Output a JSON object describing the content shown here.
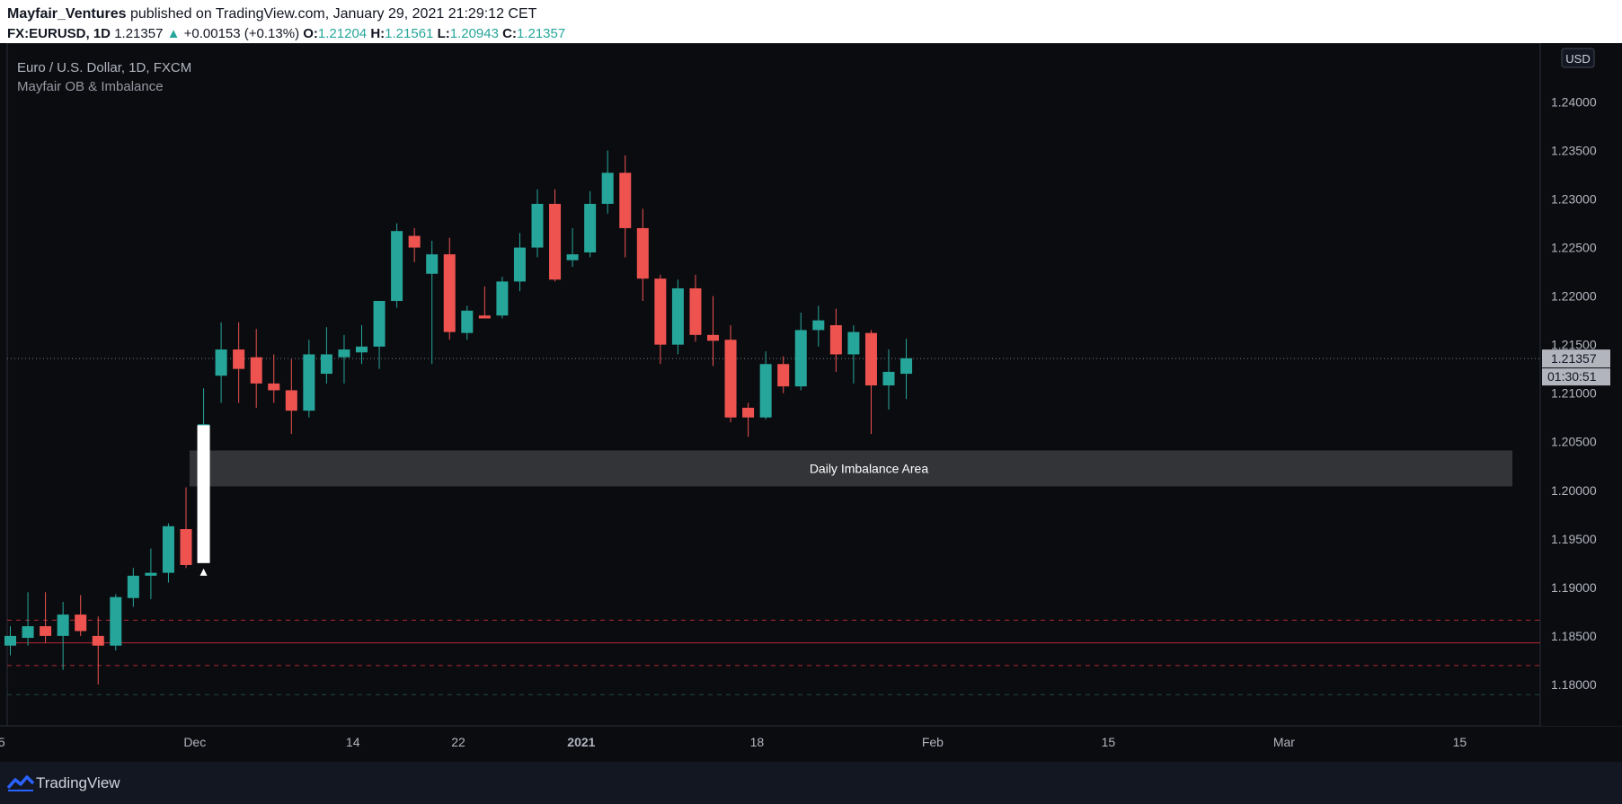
{
  "header": {
    "author": "Mayfair_Ventures",
    "published_text": "published on TradingView.com, January 29, 2021 21:29:12 CET",
    "symbol": "FX:EURUSD,",
    "interval": "1D",
    "last": "1.21357",
    "change": "+0.00153 (+0.13%)",
    "o_label": "O:",
    "o_val": "1.21204",
    "h_label": "H:",
    "h_val": "1.21561",
    "l_label": "L:",
    "l_val": "1.20943",
    "c_label": "C:",
    "c_val": "1.21357"
  },
  "chart_title": "Euro / U.S. Dollar, 1D, FXCM",
  "indicator_name": "Mayfair OB & Imbalance",
  "currency_label": "USD",
  "countdown": "01:30:51",
  "footer": {
    "brand": "TradingView"
  },
  "colors": {
    "up": "#26a69a",
    "down": "#ef5350",
    "background": "#0b0c10",
    "header_bg": "#ffffff"
  },
  "chart_data": {
    "type": "candlestick",
    "symbol": "FX:EURUSD",
    "interval": "1D",
    "ylim": [
      1.1762,
      1.2455
    ],
    "y_ticks": [
      "1.18000",
      "1.18500",
      "1.19000",
      "1.19500",
      "1.20000",
      "1.20500",
      "1.21000",
      "1.21500",
      "1.22000",
      "1.22500",
      "1.23000",
      "1.23500",
      "1.24000"
    ],
    "x_ticks": [
      {
        "label": "5",
        "bar": -0.5,
        "bold": false
      },
      {
        "label": "Dec",
        "bar": 10.5,
        "bold": false
      },
      {
        "label": "14",
        "bar": 19.5,
        "bold": false
      },
      {
        "label": "22",
        "bar": 25.5,
        "bold": false
      },
      {
        "label": "2021",
        "bar": 32.5,
        "bold": true
      },
      {
        "label": "18",
        "bar": 42.5,
        "bold": false
      },
      {
        "label": "Feb",
        "bar": 52.5,
        "bold": false
      },
      {
        "label": "15",
        "bar": 62.5,
        "bold": false
      },
      {
        "label": "Mar",
        "bar": 72.5,
        "bold": false
      },
      {
        "label": "15",
        "bar": 82.5,
        "bold": false
      }
    ],
    "candles": [
      {
        "o": 1.184,
        "h": 1.186,
        "l": 1.183,
        "c": 1.185
      },
      {
        "o": 1.1848,
        "h": 1.1895,
        "l": 1.184,
        "c": 1.186
      },
      {
        "o": 1.186,
        "h": 1.1895,
        "l": 1.1843,
        "c": 1.185
      },
      {
        "o": 1.185,
        "h": 1.1885,
        "l": 1.1815,
        "c": 1.1872
      },
      {
        "o": 1.1872,
        "h": 1.1892,
        "l": 1.185,
        "c": 1.1855
      },
      {
        "o": 1.185,
        "h": 1.187,
        "l": 1.18,
        "c": 1.184
      },
      {
        "o": 1.184,
        "h": 1.1893,
        "l": 1.1835,
        "c": 1.189
      },
      {
        "o": 1.1889,
        "h": 1.192,
        "l": 1.188,
        "c": 1.1912
      },
      {
        "o": 1.1912,
        "h": 1.194,
        "l": 1.1888,
        "c": 1.1915
      },
      {
        "o": 1.1915,
        "h": 1.1966,
        "l": 1.1905,
        "c": 1.1963
      },
      {
        "o": 1.196,
        "h": 1.2003,
        "l": 1.192,
        "c": 1.1923
      },
      {
        "o": 1.2021,
        "h": 1.2105,
        "l": 1.2015,
        "c": 1.2068
      },
      {
        "o": 1.2118,
        "h": 1.2173,
        "l": 1.209,
        "c": 1.2145
      },
      {
        "o": 1.2145,
        "h": 1.2173,
        "l": 1.209,
        "c": 1.2125
      },
      {
        "o": 1.2137,
        "h": 1.2166,
        "l": 1.2085,
        "c": 1.211
      },
      {
        "o": 1.211,
        "h": 1.214,
        "l": 1.209,
        "c": 1.2103
      },
      {
        "o": 1.2103,
        "h": 1.2135,
        "l": 1.2058,
        "c": 1.2082
      },
      {
        "o": 1.2082,
        "h": 1.2155,
        "l": 1.2075,
        "c": 1.214
      },
      {
        "o": 1.212,
        "h": 1.2168,
        "l": 1.211,
        "c": 1.214
      },
      {
        "o": 1.2137,
        "h": 1.216,
        "l": 1.211,
        "c": 1.2145
      },
      {
        "o": 1.2142,
        "h": 1.217,
        "l": 1.213,
        "c": 1.2148
      },
      {
        "o": 1.2148,
        "h": 1.2195,
        "l": 1.2125,
        "c": 1.2195
      },
      {
        "o": 1.2195,
        "h": 1.2275,
        "l": 1.2188,
        "c": 1.2267
      },
      {
        "o": 1.2262,
        "h": 1.227,
        "l": 1.2235,
        "c": 1.225
      },
      {
        "o": 1.2223,
        "h": 1.2257,
        "l": 1.213,
        "c": 1.2243
      },
      {
        "o": 1.2243,
        "h": 1.226,
        "l": 1.2155,
        "c": 1.2163
      },
      {
        "o": 1.2162,
        "h": 1.219,
        "l": 1.2155,
        "c": 1.2185
      },
      {
        "o": 1.218,
        "h": 1.221,
        "l": 1.2178,
        "c": 1.2177
      },
      {
        "o": 1.218,
        "h": 1.222,
        "l": 1.2177,
        "c": 1.2215
      },
      {
        "o": 1.2215,
        "h": 1.2265,
        "l": 1.2205,
        "c": 1.225
      },
      {
        "o": 1.225,
        "h": 1.231,
        "l": 1.224,
        "c": 1.2295
      },
      {
        "o": 1.2295,
        "h": 1.231,
        "l": 1.2215,
        "c": 1.2217
      },
      {
        "o": 1.2237,
        "h": 1.227,
        "l": 1.223,
        "c": 1.2243
      },
      {
        "o": 1.2245,
        "h": 1.2308,
        "l": 1.224,
        "c": 1.2295
      },
      {
        "o": 1.2295,
        "h": 1.235,
        "l": 1.2285,
        "c": 1.2327
      },
      {
        "o": 1.2327,
        "h": 1.2345,
        "l": 1.224,
        "c": 1.227
      },
      {
        "o": 1.227,
        "h": 1.229,
        "l": 1.2195,
        "c": 1.2218
      },
      {
        "o": 1.2218,
        "h": 1.2222,
        "l": 1.213,
        "c": 1.215
      },
      {
        "o": 1.215,
        "h": 1.2217,
        "l": 1.214,
        "c": 1.2208
      },
      {
        "o": 1.2208,
        "h": 1.2222,
        "l": 1.2153,
        "c": 1.216
      },
      {
        "o": 1.216,
        "h": 1.22,
        "l": 1.2128,
        "c": 1.2154
      },
      {
        "o": 1.2155,
        "h": 1.217,
        "l": 1.207,
        "c": 1.2075
      },
      {
        "o": 1.2085,
        "h": 1.209,
        "l": 1.2055,
        "c": 1.2075
      },
      {
        "o": 1.2075,
        "h": 1.2143,
        "l": 1.2073,
        "c": 1.213
      },
      {
        "o": 1.213,
        "h": 1.2138,
        "l": 1.21,
        "c": 1.2107
      },
      {
        "o": 1.2107,
        "h": 1.2183,
        "l": 1.2103,
        "c": 1.2165
      },
      {
        "o": 1.2165,
        "h": 1.219,
        "l": 1.2148,
        "c": 1.2175
      },
      {
        "o": 1.217,
        "h": 1.2187,
        "l": 1.2122,
        "c": 1.214
      },
      {
        "o": 1.214,
        "h": 1.217,
        "l": 1.211,
        "c": 1.2163
      },
      {
        "o": 1.2162,
        "h": 1.2165,
        "l": 1.2058,
        "c": 1.2108
      },
      {
        "o": 1.2108,
        "h": 1.2145,
        "l": 1.2083,
        "c": 1.2122
      },
      {
        "o": 1.212,
        "h": 1.2156,
        "l": 1.2094,
        "c": 1.2136
      }
    ],
    "last_price": 1.21357,
    "imbalance_zone": {
      "top": 1.2041,
      "bottom": 1.2004,
      "start_bar": 10.2,
      "end_bar": 85.5,
      "label": "Daily Imbalance Area"
    },
    "marker_bar": {
      "bar": 11,
      "top": 1.2067,
      "bottom": 1.1925
    },
    "levels": [
      {
        "price": 1.18662,
        "style": "dashed",
        "color": "#b22833"
      },
      {
        "price": 1.18429,
        "style": "solid",
        "color": "#b22833"
      },
      {
        "price": 1.18195,
        "style": "dashed",
        "color": "#b22833"
      },
      {
        "price": 1.17895,
        "style": "dashed",
        "color": "#1f4d3a"
      }
    ]
  }
}
